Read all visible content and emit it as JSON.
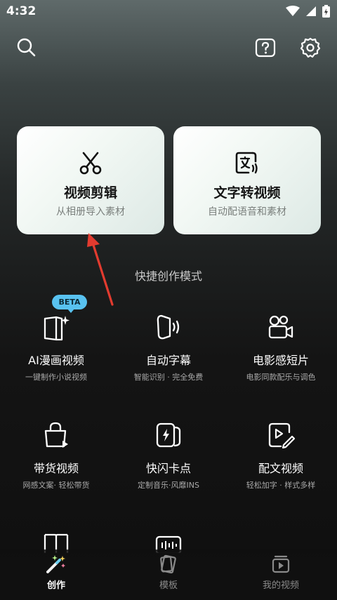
{
  "status_bar": {
    "time": "4:32"
  },
  "cards": [
    {
      "title": "视频剪辑",
      "subtitle": "从相册导入素材",
      "icon": "scissors-icon"
    },
    {
      "title": "文字转视频",
      "subtitle": "自动配语音和素材",
      "icon": "text-to-video-icon"
    }
  ],
  "section_title": "快捷创作模式",
  "beta_badge": "BETA",
  "features": [
    {
      "title": "AI漫画视频",
      "subtitle": "一键制作小说视频",
      "icon": "ai-comic-icon"
    },
    {
      "title": "自动字幕",
      "subtitle": "智能识别 · 完全免费",
      "icon": "auto-caption-icon"
    },
    {
      "title": "电影感短片",
      "subtitle": "电影同款配乐与调色",
      "icon": "movie-camera-icon"
    },
    {
      "title": "带货视频",
      "subtitle": "网感文案· 轻松带货",
      "icon": "shopping-bag-icon"
    },
    {
      "title": "快闪卡点",
      "subtitle": "定制音乐·风靡INS",
      "icon": "flash-beat-icon"
    },
    {
      "title": "配文视频",
      "subtitle": "轻松加字 · 样式多样",
      "icon": "text-video-icon"
    }
  ],
  "bottom_nav": [
    {
      "label": "创作",
      "icon": "magic-wand-icon",
      "active": true
    },
    {
      "label": "模板",
      "icon": "template-icon",
      "active": false
    },
    {
      "label": "我的视频",
      "icon": "my-video-icon",
      "active": false
    }
  ],
  "colors": {
    "beta_badge": "#58c2f0",
    "accent_arrow": "#e23b2f"
  }
}
